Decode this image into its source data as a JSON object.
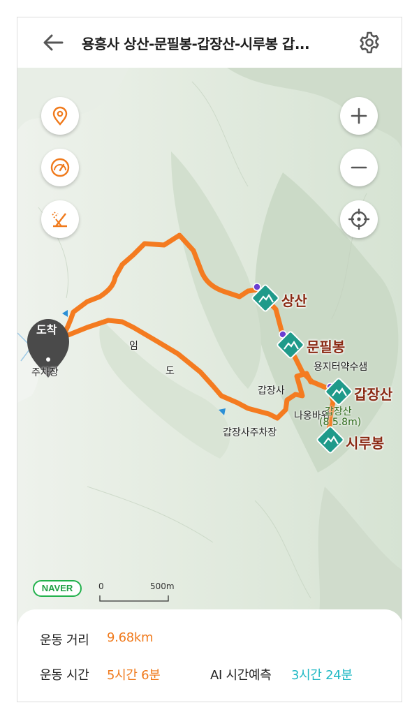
{
  "header": {
    "back_icon": "arrow-left-icon",
    "title": "용흥사 상산-문필봉-갑장산-시루봉 갑...",
    "settings_icon": "gear-icon"
  },
  "map_controls": {
    "left": [
      "location-pin-icon",
      "speedometer-icon",
      "route-slope-icon"
    ],
    "right": [
      "zoom-in-icon",
      "zoom-out-icon",
      "crosshair-locate-icon"
    ]
  },
  "map": {
    "route_color": "#f47b20",
    "peaks": [
      {
        "name": "상산"
      },
      {
        "name": "문필봉"
      },
      {
        "name": "갑장산"
      },
      {
        "name": "시루봉"
      }
    ],
    "place_labels": {
      "parking": "주차장",
      "arrival_badge": "도착",
      "forest_road_1": "임",
      "forest_road_2": "도",
      "spring": "용지터약수샘",
      "temple": "갑장사",
      "rock": "나옹바위",
      "peak_detail_name": "갑장산",
      "peak_detail_alt": "(8 5.8m)",
      "temple_parking": "갑장사주차장"
    },
    "brand": "NAVER",
    "scale": {
      "start": "0",
      "end": "500m"
    }
  },
  "stats": {
    "distance_label": "운동 거리",
    "distance_value": "9.68km",
    "time_label": "운동 시간",
    "time_value": "5시간 6분",
    "ai_label": "AI 시간예측",
    "ai_value": "3시간 24분"
  },
  "colors": {
    "accent_orange": "#f07a1c",
    "accent_teal": "#1fb8c4",
    "peak_label": "#8a2a14",
    "map_bg": "#dfe8dc"
  }
}
